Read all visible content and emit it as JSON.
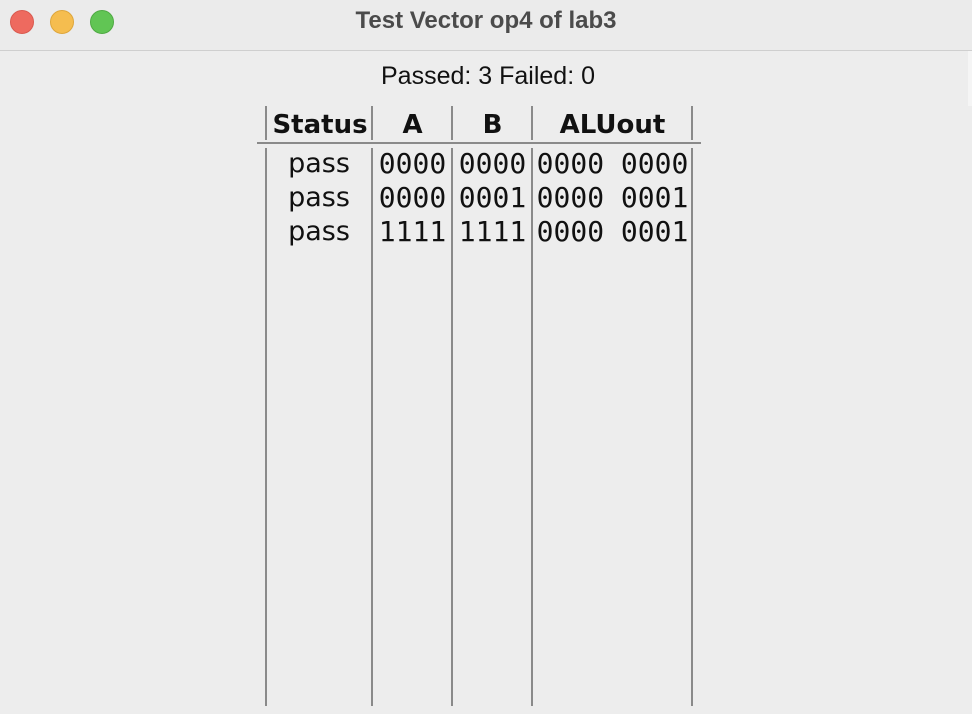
{
  "window": {
    "title": "Test Vector op4 of lab3"
  },
  "summary": "Passed: 3 Failed: 0",
  "table": {
    "columns": [
      "Status",
      "A",
      "B",
      "ALUout"
    ],
    "rows": [
      [
        "pass",
        "0000",
        "0000",
        "0000 0000"
      ],
      [
        "pass",
        "0000",
        "0001",
        "0000 0001"
      ],
      [
        "pass",
        "1111",
        "1111",
        "0000 0001"
      ]
    ]
  },
  "colors": {
    "close": "#ee6a5f",
    "minimize": "#f5bd4f",
    "zoom": "#61c554"
  }
}
